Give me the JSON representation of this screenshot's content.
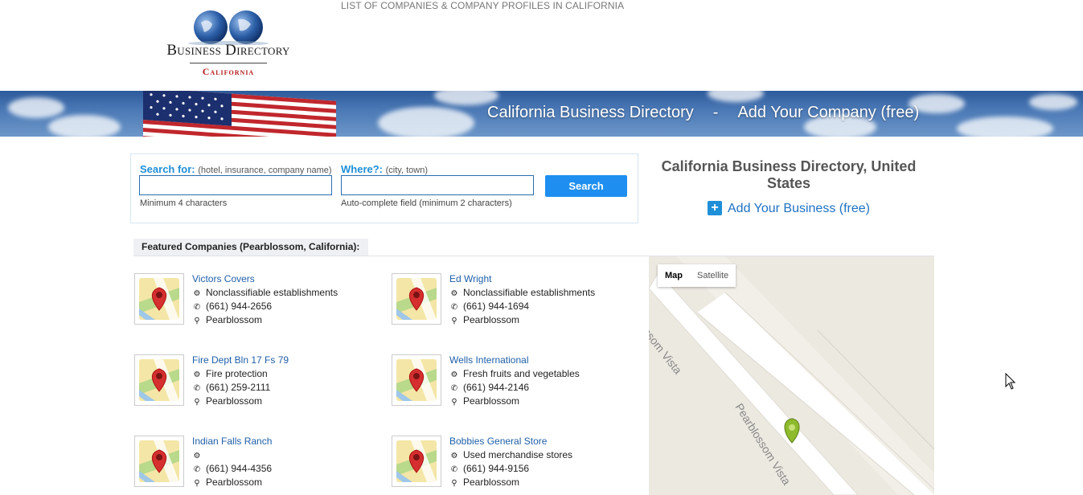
{
  "header": {
    "logo_title": "Business Directory",
    "logo_subtitle": "California",
    "tagline": "LIST OF COMPANIES & COMPANY PROFILES IN CALIFORNIA"
  },
  "banner": {
    "link_directory": "California Business Directory",
    "separator": "-",
    "link_add": "Add Your Company (free)"
  },
  "search": {
    "search_for_label": "Search for:",
    "search_for_hint": "(hotel, insurance, company name)",
    "search_for_value": "",
    "search_for_note": "Minimum 4 characters",
    "where_label": "Where?:",
    "where_hint": "(city, town)",
    "where_value": "",
    "where_note": "Auto-complete field (minimum 2 characters)",
    "button_label": "Search"
  },
  "sidebar": {
    "title": "California Business Directory, United States",
    "add_business": "Add Your Business (free)"
  },
  "featured": {
    "heading": "Featured Companies (Pearblossom, California):",
    "companies": [
      {
        "name": "Victors Covers",
        "category": "Nonclassifiable establishments",
        "phone": "(661) 944-2656",
        "city": "Pearblossom"
      },
      {
        "name": "Ed Wright",
        "category": "Nonclassifiable establishments",
        "phone": "(661) 944-1694",
        "city": "Pearblossom"
      },
      {
        "name": "Fire Dept Bln 17 Fs 79",
        "category": "Fire protection",
        "phone": "(661) 259-2111",
        "city": "Pearblossom"
      },
      {
        "name": "Wells International",
        "category": "Fresh fruits and vegetables",
        "phone": "(661) 944-2146",
        "city": "Pearblossom"
      },
      {
        "name": "Indian Falls Ranch",
        "category": "",
        "phone": "(661) 944-4356",
        "city": "Pearblossom"
      },
      {
        "name": "Bobbies General Store",
        "category": "Used merchandise stores",
        "phone": "(661) 944-9156",
        "city": "Pearblossom"
      }
    ]
  },
  "map": {
    "btn_map": "Map",
    "btn_satellite": "Satellite",
    "road_label_1": "Blossom Vista",
    "road_label_2": "Pearblossom Vista"
  },
  "icons": {
    "category": "gears-icon",
    "phone": "phone-icon",
    "location": "map-marker-icon"
  },
  "colors": {
    "accent": "#1f8fd8",
    "link": "#1f5fa8",
    "search_button": "#1e8ff0",
    "logo_red": "#b51c1c"
  }
}
